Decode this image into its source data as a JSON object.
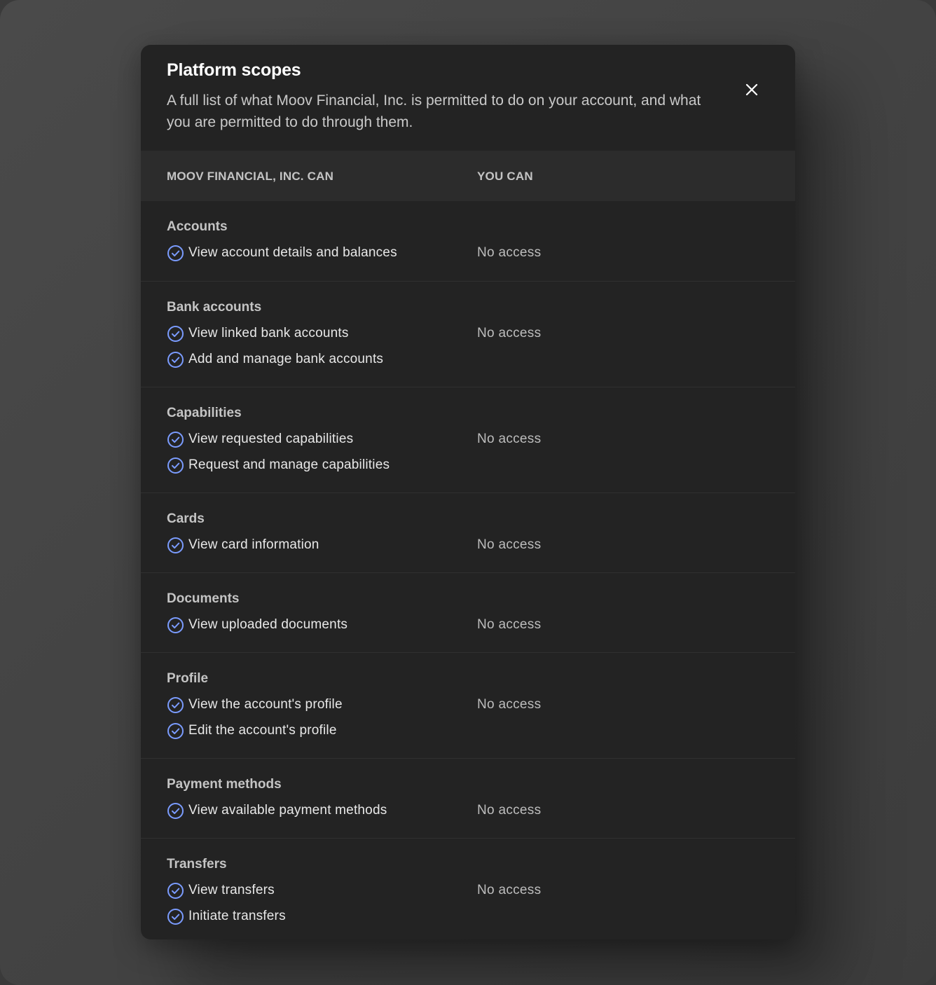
{
  "modal": {
    "title": "Platform scopes",
    "subtitle": "A full list of what Moov Financial, Inc. is permitted to do on your account, and what you are permitted to do through them.",
    "close_icon": "close-icon"
  },
  "table": {
    "header_left": "MOOV FINANCIAL, INC. CAN",
    "header_right": "YOU CAN"
  },
  "sections": [
    {
      "title": "Accounts",
      "scopes": [
        "View account details and balances"
      ],
      "you_can": "No access"
    },
    {
      "title": "Bank accounts",
      "scopes": [
        "View linked bank accounts",
        "Add and manage bank accounts"
      ],
      "you_can": "No access"
    },
    {
      "title": "Capabilities",
      "scopes": [
        "View requested capabilities",
        "Request and manage capabilities"
      ],
      "you_can": "No access"
    },
    {
      "title": "Cards",
      "scopes": [
        "View card information"
      ],
      "you_can": "No access"
    },
    {
      "title": "Documents",
      "scopes": [
        "View uploaded documents"
      ],
      "you_can": "No access"
    },
    {
      "title": "Profile",
      "scopes": [
        "View the account's profile",
        "Edit the account's profile"
      ],
      "you_can": "No access"
    },
    {
      "title": "Payment methods",
      "scopes": [
        "View available payment methods"
      ],
      "you_can": "No access"
    },
    {
      "title": "Transfers",
      "scopes": [
        "View transfers",
        "Initiate transfers"
      ],
      "you_can": "No access"
    }
  ],
  "colors": {
    "check": "#7b9cff",
    "modal_bg": "#232323",
    "header_row_bg": "#2c2c2c"
  }
}
